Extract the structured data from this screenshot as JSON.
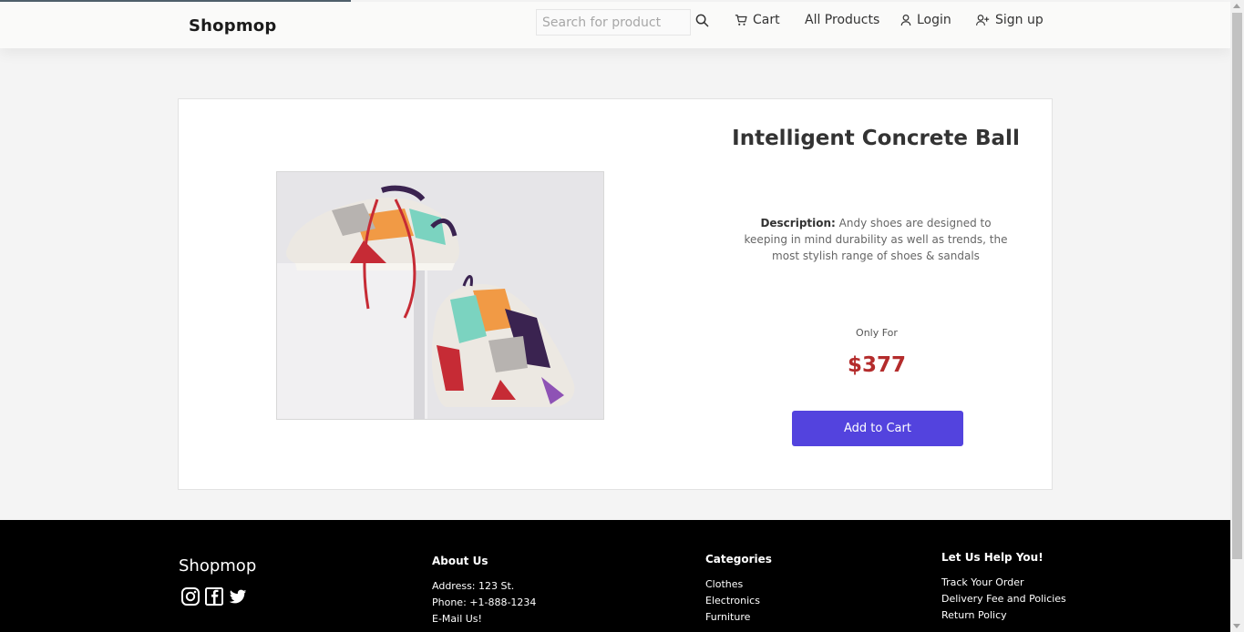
{
  "header": {
    "brand": "Shopmop",
    "search_placeholder": "Search for product",
    "nav": {
      "cart": "Cart",
      "all_products": "All Products",
      "login": "Login",
      "signup": "Sign up"
    }
  },
  "product": {
    "title": "Intelligent Concrete Ball",
    "description_label": "Description:",
    "description": " Andy shoes are designed to keeping in mind durability as well as trends, the most stylish range of shoes & sandals",
    "only_for": "Only For",
    "price": "$377",
    "add_to_cart": "Add to Cart",
    "image_icon": "sneakers-photo"
  },
  "footer": {
    "brand": "Shopmop",
    "social_icons": [
      "instagram-icon",
      "facebook-icon",
      "twitter-icon"
    ],
    "about": {
      "heading": "About Us",
      "lines": [
        "Address: 123 St.",
        "Phone: +1-888-1234",
        "E-Mail Us!"
      ]
    },
    "categories": {
      "heading": "Categories",
      "items": [
        "Clothes",
        "Electronics",
        "Furniture"
      ]
    },
    "help": {
      "heading": "Let Us Help You!",
      "items": [
        "Track Your Order",
        "Delivery Fee and Policies",
        "Return Policy"
      ]
    }
  },
  "colors": {
    "accent": "#5343de",
    "price": "#b42c2c",
    "footer_bg": "#000000"
  }
}
